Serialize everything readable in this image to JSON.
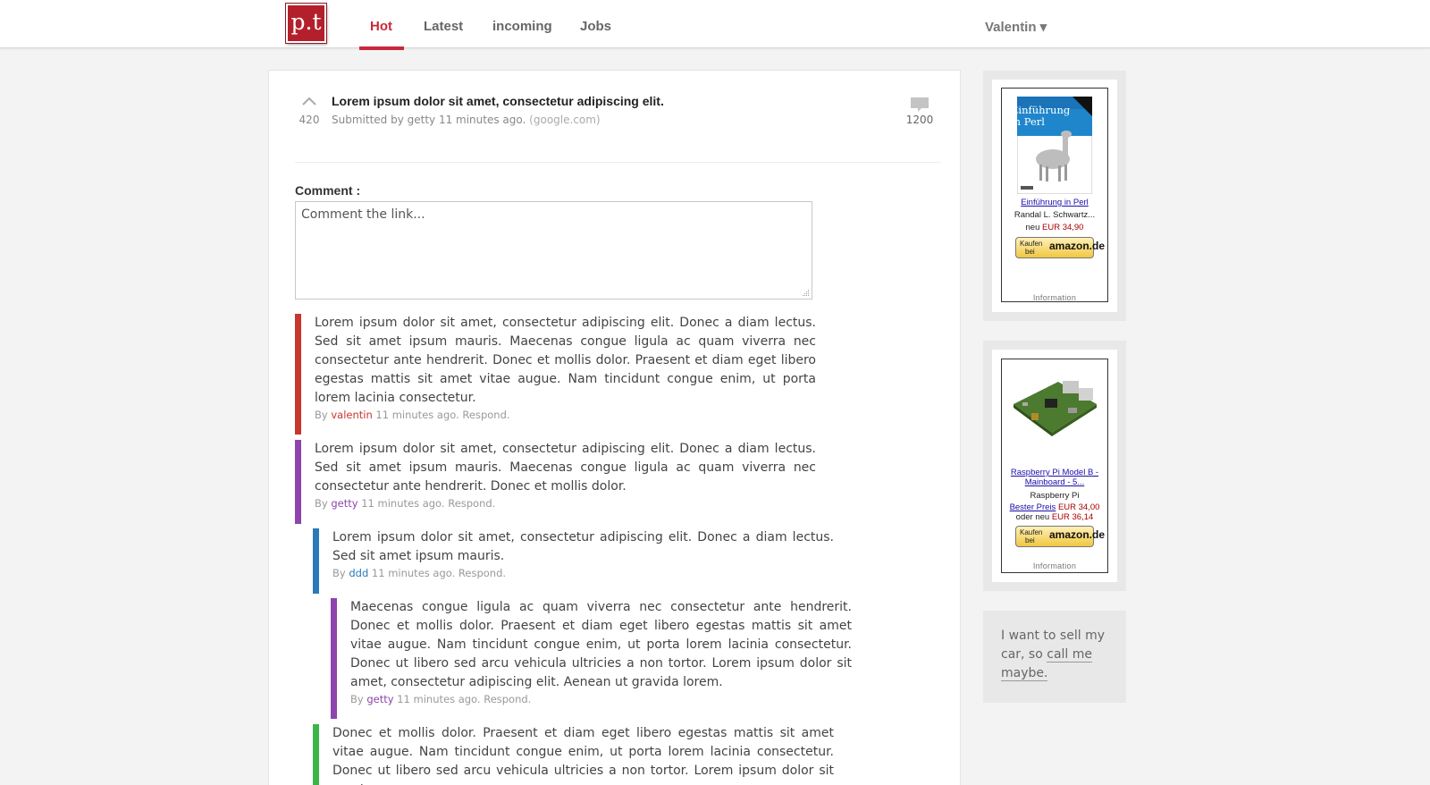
{
  "header": {
    "logo_text": "p.t",
    "nav": [
      {
        "label": "Hot",
        "active": true
      },
      {
        "label": "Latest",
        "active": false
      },
      {
        "label": "incoming",
        "active": false
      },
      {
        "label": "Jobs",
        "active": false
      }
    ],
    "user_label": "Valentin ▾",
    "accent_color": "#c9283a"
  },
  "post": {
    "vote_icon": "upvote-chevron-icon",
    "votes": "420",
    "title": "Lorem ipsum dolor sit amet, consectetur adipiscing elit.",
    "meta_prefix": "Submitted by getty 11 minutes ago.",
    "domain": "(google.com)",
    "comment_icon": "speech-bubble-icon",
    "comment_count": "1200"
  },
  "comment_form": {
    "label": "Comment :",
    "placeholder": "Comment the link..."
  },
  "comments": [
    {
      "text": "Lorem ipsum dolor sit amet, consectetur adipiscing elit. Donec a diam lectus. Sed sit amet ipsum mauris. Maecenas congue ligula ac quam viverra nec consectetur ante hendrerit. Donec et mollis dolor. Praesent et diam eget libero egestas mattis sit amet vitae augue. Nam tincidunt congue enim, ut porta lorem lacinia consectetur.",
      "by": "By",
      "author": "valentin",
      "time": "11 minutes ago.",
      "respond": "Respond.",
      "color": "#c9352f"
    },
    {
      "text": "Lorem ipsum dolor sit amet, consectetur adipiscing elit. Donec a diam lectus. Sed sit amet ipsum mauris. Maecenas congue ligula ac quam viverra nec consectetur ante hendrerit. Donec et mollis dolor.",
      "by": "By",
      "author": "getty",
      "time": "11 minutes ago.",
      "respond": "Respond.",
      "color": "#8e44ad"
    },
    {
      "text": "Lorem ipsum dolor sit amet, consectetur adipiscing elit. Donec a diam lectus. Sed sit amet ipsum mauris.",
      "by": "By",
      "author": "ddd",
      "time": "11 minutes ago.",
      "respond": "Respond.",
      "color": "#2a7ab8"
    },
    {
      "text": "Maecenas congue ligula ac quam viverra nec consectetur ante hendrerit. Donec et mollis dolor. Praesent et diam eget libero egestas mattis sit amet vitae augue. Nam tincidunt congue enim, ut porta lorem lacinia consectetur. Donec ut libero sed arcu vehicula ultricies a non tortor. Lorem ipsum dolor sit amet, consectetur adipiscing elit. Aenean ut gravida lorem.",
      "by": "By",
      "author": "getty",
      "time": "11 minutes ago.",
      "respond": "Respond.",
      "color": "#8e44ad"
    },
    {
      "text": "Donec et mollis dolor. Praesent et diam eget libero egestas mattis sit amet vitae augue. Nam tincidunt congue enim, ut porta lorem lacinia consectetur. Donec ut libero sed arcu vehicula ultricies a non tortor. Lorem ipsum dolor sit amet,",
      "color": "#3cb54a"
    }
  ],
  "sidebar": {
    "ad1": {
      "image_icon": "book-cover-llama-icon",
      "cover_title": "Einführung in Perl",
      "title": "Einführung in Perl",
      "author": "Randal L. Schwartz...",
      "price_prefix": "neu",
      "price": "EUR 34,90",
      "button_top": "Kaufen",
      "button_bottom": "bei",
      "button_brand": "amazon.de",
      "info": "Information"
    },
    "ad2": {
      "image_icon": "circuit-board-icon",
      "title_line1": "Raspberry Pi Model B -",
      "title_line2": "Mainboard - 5...",
      "brand": "Raspberry Pi",
      "best_price_label": "Bester Preis",
      "best_price": "EUR 34,00",
      "new_price_label": "oder neu",
      "new_price": "EUR 36,14",
      "button_top": "Kaufen",
      "button_bottom": "bei",
      "button_brand": "amazon.de",
      "info": "Information"
    },
    "sell": {
      "text": "I want to sell my car, so",
      "link": "call me maybe."
    }
  }
}
